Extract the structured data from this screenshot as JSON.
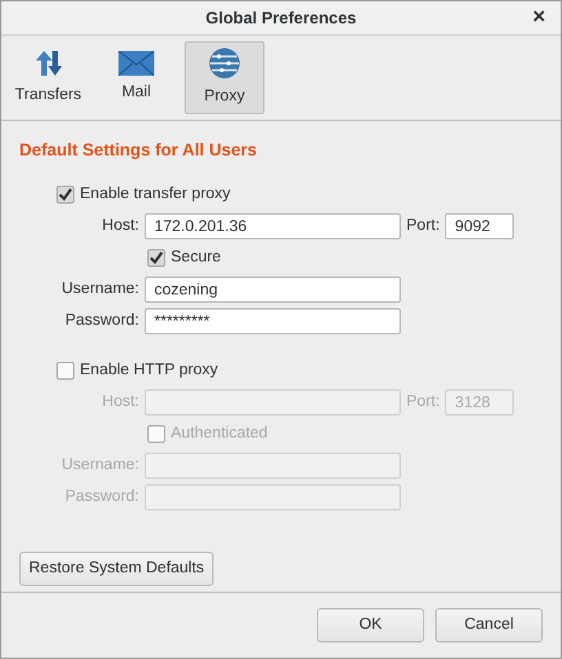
{
  "window": {
    "title": "Global Preferences",
    "close": "×"
  },
  "tabs": [
    {
      "label": "Transfers",
      "kind": "transfers",
      "selected": false
    },
    {
      "label": "Mail",
      "kind": "mail",
      "selected": false
    },
    {
      "label": "Proxy",
      "kind": "proxy",
      "selected": true
    }
  ],
  "heading": "Default Settings for All Users",
  "proxies": [
    {
      "enable_label": "Enable transfer proxy",
      "checked": true,
      "host_label": "Host:",
      "host": "172.0.201.36",
      "port_label": "Port:",
      "port": "9092",
      "option_label": "Secure",
      "option_checked": true,
      "username_label": "Username:",
      "username": "cozening",
      "password_label": "Password:",
      "password": "*********"
    },
    {
      "enable_label": "Enable HTTP proxy",
      "checked": false,
      "host_label": "Host:",
      "port_label": "Port:",
      "port": "3128",
      "option_label": "Authenticated",
      "option_checked": false,
      "username_label": "Username:",
      "password_label": "Password:"
    }
  ],
  "restore_button": "Restore System Defaults",
  "buttons": [
    "OK",
    "Cancel"
  ]
}
